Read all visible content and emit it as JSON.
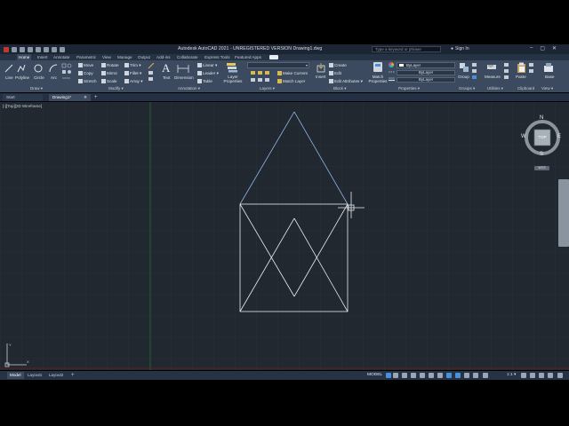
{
  "app": {
    "title": "Autodesk AutoCAD 2021 - UNREGISTERED VERSION    Drawing1.dwg",
    "search_placeholder": "Type a keyword or phrase",
    "sign_in": "Sign In"
  },
  "ribbon_tabs": [
    "Home",
    "Insert",
    "Annotate",
    "Parametric",
    "View",
    "Manage",
    "Output",
    "Add-ins",
    "Collaborate",
    "Express Tools",
    "Featured Apps"
  ],
  "panels": {
    "draw": {
      "title": "Draw ▾",
      "line": "Line",
      "polyline": "Polyline",
      "circle": "Circle",
      "arc": "Arc"
    },
    "modify": {
      "title": "Modify ▾",
      "move": "Move",
      "rotate": "Rotate",
      "trim": "Trim ▾",
      "copy": "Copy",
      "mirror": "Mirror",
      "fillet": "Fillet ▾",
      "stretch": "Stretch",
      "scale": "Scale",
      "array": "Array ▾"
    },
    "annotation": {
      "title": "Annotation ▾",
      "text": "Text",
      "dimension": "Dimension",
      "linear": "Linear ▾",
      "leader": "Leader ▾",
      "table": "Table"
    },
    "layers": {
      "title": "Layers ▾",
      "layer_properties": "Layer Properties",
      "make_current": "Make Current",
      "match_layer": "Match Layer"
    },
    "block": {
      "title": "Block ▾",
      "insert": "Insert",
      "create": "Create",
      "edit": "Edit",
      "edit_attributes": "Edit Attributes ▾"
    },
    "properties": {
      "title": "Properties ▾",
      "match": "Match Properties",
      "bylayer1": "ByLayer",
      "bylayer2": "ByLayer",
      "bylayer3": "ByLayer"
    },
    "groups": {
      "title": "Groups ▾",
      "group": "Group"
    },
    "utilities": {
      "title": "Utilities ▾",
      "measure": "Measure"
    },
    "clipboard": {
      "title": "Clipboard",
      "paste": "Paste"
    },
    "view": {
      "title": "View ▾",
      "base": "Base"
    }
  },
  "file_tabs": [
    "Start",
    "Drawing1*"
  ],
  "viewport": {
    "label": "[-][Top][2D Wireframe]",
    "wcs": "WCS"
  },
  "viewcube": {
    "n": "N",
    "s": "S",
    "e": "E",
    "w": "W",
    "top": "TOP"
  },
  "layout_tabs": [
    "Model",
    "Layout1",
    "Layout2"
  ],
  "status": {
    "model": "MODEL",
    "scale": "1:1 ▾"
  },
  "colors": {
    "accent": "#4a90d9",
    "canvas": "#212830",
    "ribbon": "#3b4a5e"
  }
}
